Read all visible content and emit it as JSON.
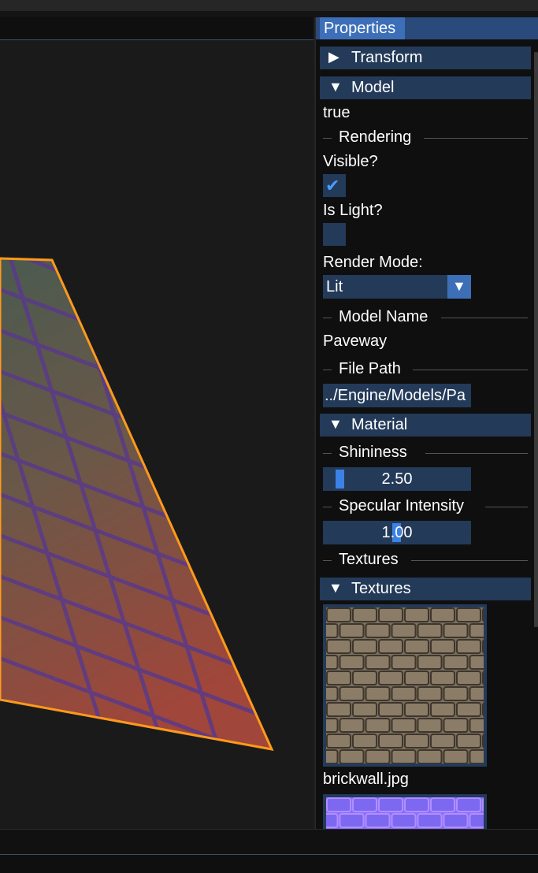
{
  "panel": {
    "title": "Properties",
    "sections": {
      "transform": {
        "arrow": "▶",
        "label": "Transform"
      },
      "model": {
        "arrow": "▼",
        "label": "Model"
      },
      "material": {
        "arrow": "▼",
        "label": "Material"
      },
      "textures": {
        "arrow": "▼",
        "label": "Textures"
      }
    },
    "model": {
      "active_value": "true",
      "rendering_label": "Rendering",
      "visible_label": "Visible?",
      "visible_checked": true,
      "is_light_label": "Is Light?",
      "is_light_checked": false,
      "render_mode_label": "Render Mode:",
      "render_mode_value": "Lit",
      "model_name_label": "Model Name",
      "model_name_value": "Paveway",
      "file_path_label": "File Path",
      "file_path_value": "../Engine/Models/Pa"
    },
    "material": {
      "shininess_label": "Shininess",
      "shininess_value": "2.50",
      "specular_label": "Specular Intensity",
      "specular_value": "1.00",
      "textures_label": "Textures"
    },
    "textures": {
      "items": [
        {
          "filename": "brickwall.jpg"
        }
      ]
    }
  },
  "viewport": {
    "selection_outline_color": "#ff9a1a"
  },
  "colors": {
    "accent": "#3c6fb8",
    "header_bg": "#243a59",
    "checkmark": "#4a9cff"
  }
}
